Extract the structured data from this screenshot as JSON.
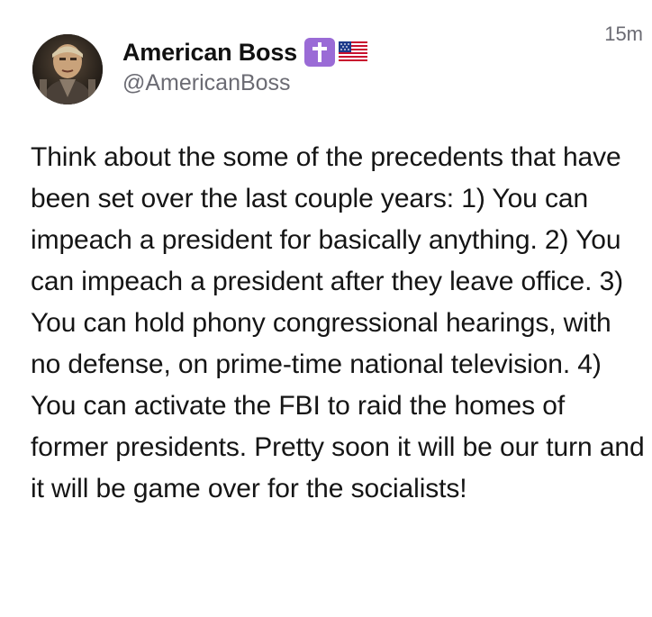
{
  "author": {
    "display_name": "American Boss",
    "badges": [
      "latin-cross-emoji",
      "us-flag-emoji"
    ],
    "handle": "@AmericanBoss",
    "avatar_icon": "avatar-photo"
  },
  "timestamp": "15m",
  "post": {
    "text": "Think about the some of the precedents that have been set over the last couple years: 1) You can impeach a president for basically anything. 2) You can impeach a president after they leave office. 3) You can hold phony congressional hearings, with no defense, on prime-time national television. 4) You can activate the FBI to raid the homes of former presidents. Pretty soon it will be our turn and it will be game over for the socialists!"
  },
  "colors": {
    "text_primary": "#111111",
    "text_secondary": "#6b6b73",
    "cross_badge": "#9a6bd6",
    "background": "#ffffff"
  }
}
